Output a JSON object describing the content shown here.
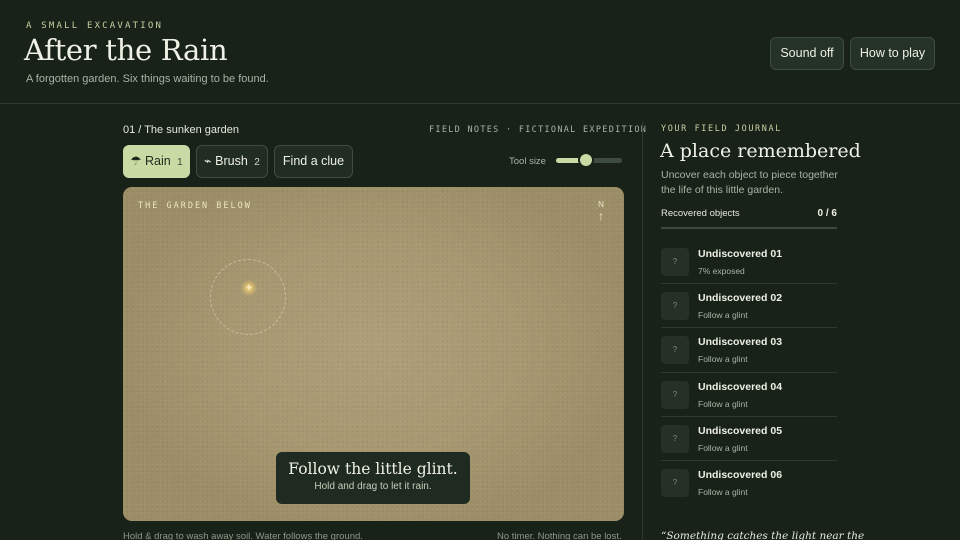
{
  "header": {
    "kicker": "A SMALL EXCAVATION",
    "title": "After the Rain",
    "subtitle": "A forgotten garden. Six things waiting to be found.",
    "sound_label": "Sound off",
    "how_label": "How to play"
  },
  "main": {
    "section_label": "01 / The sunken garden",
    "field_notes": "FIELD NOTES · FICTIONAL EXPEDITION",
    "tools": [
      {
        "icon": "☂",
        "label": "Rain",
        "key": "1",
        "active": true
      },
      {
        "icon": "⌁",
        "label": "Brush",
        "key": "2",
        "active": false
      },
      {
        "label": "Find a clue"
      }
    ],
    "tool_size_label": "Tool size",
    "tool_size_level": 0.45,
    "garden": {
      "label": "THE GARDEN BELOW",
      "compass_label": "N",
      "compass_arrow": "↑",
      "glint_symbol": "+",
      "hint_title": "Follow the little glint.",
      "hint_sub": "Hold and drag to let it rain."
    },
    "footer_left": "Hold & drag to wash away soil. Water follows the ground.",
    "footer_right": "No timer. Nothing can be lost."
  },
  "journal": {
    "kicker": "YOUR FIELD JOURNAL",
    "title": "A place remembered",
    "description": "Uncover each object to piece together the life of this little garden.",
    "recovered_label": "Recovered objects",
    "recovered_count": "0 / 6",
    "recovered_fraction": 0,
    "items": [
      {
        "thumb": "?",
        "name": "Undiscovered 01",
        "status": "7% exposed"
      },
      {
        "thumb": "?",
        "name": "Undiscovered 02",
        "status": "Follow a glint"
      },
      {
        "thumb": "?",
        "name": "Undiscovered 03",
        "status": "Follow a glint"
      },
      {
        "thumb": "?",
        "name": "Undiscovered 04",
        "status": "Follow a glint"
      },
      {
        "thumb": "?",
        "name": "Undiscovered 05",
        "status": "Follow a glint"
      },
      {
        "thumb": "?",
        "name": "Undiscovered 06",
        "status": "Follow a glint"
      }
    ],
    "quote": "“Something catches the light near the"
  },
  "colors": {
    "background": "#182219",
    "accent": "#c9dba4",
    "soil": "#a69870"
  }
}
